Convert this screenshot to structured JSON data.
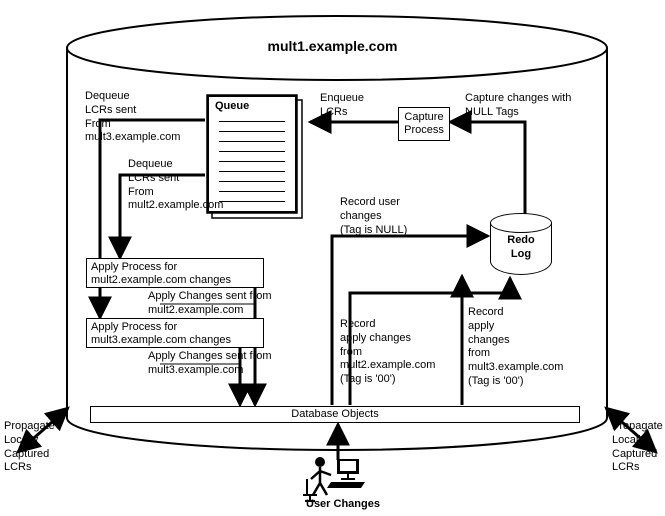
{
  "title": "mult1.example.com",
  "queue_label": "Queue",
  "capture_box": "Capture\nProcess",
  "redo_label": "Redo\nLog",
  "apply2_box": "Apply Process for\nmult2.example.com changes",
  "apply3_box": "Apply Process for\nmult3.example.com changes",
  "db_objects": "Database Objects",
  "user_changes_label": "User Changes",
  "left_prop": "Propagate\nLocally\nCaptured\nLCRs",
  "right_prop": "Propagate\nLocally\nCaptured\nLCRs",
  "dequeue_mult3": "Dequeue\nLCRs sent\nFrom\nmult3.example.com",
  "dequeue_mult2": "Dequeue\nLCRs sent\nFrom\nmult2.example.com",
  "enqueue_lcrs": "Enqueue\nLCRs",
  "capture_null": "Capture changes with\nNULL Tags",
  "record_user": "Record user\nchanges\n(Tag is NULL)",
  "apply_sent_m2": "Apply Changes sent from\nmult2.example.com",
  "apply_sent_m3": "Apply Changes sent from\nmult3.example.com",
  "record_apply_m2": "Record\napply changes\nfrom\nmult2.example.com\n(Tag is '00')",
  "record_apply_m3": "Record\napply\nchanges\nfrom\nmult3.example.com\n(Tag is '00')",
  "chart_data": {
    "type": "diagram",
    "host": "mult1.example.com",
    "nodes": [
      {
        "id": "queue",
        "label": "Queue"
      },
      {
        "id": "capture",
        "label": "Capture Process"
      },
      {
        "id": "redo",
        "label": "Redo Log"
      },
      {
        "id": "apply_m2",
        "label": "Apply Process for mult2.example.com changes"
      },
      {
        "id": "apply_m3",
        "label": "Apply Process for mult3.example.com changes"
      },
      {
        "id": "db_objects",
        "label": "Database Objects"
      },
      {
        "id": "user",
        "label": "User Changes"
      }
    ],
    "edges": [
      {
        "from": "redo",
        "to": "capture",
        "label": "Capture changes with NULL Tags"
      },
      {
        "from": "capture",
        "to": "queue",
        "label": "Enqueue LCRs"
      },
      {
        "from": "queue",
        "to": "apply_m3",
        "label": "Dequeue LCRs sent From mult3.example.com"
      },
      {
        "from": "queue",
        "to": "apply_m2",
        "label": "Dequeue LCRs sent From mult2.example.com"
      },
      {
        "from": "apply_m2",
        "to": "db_objects",
        "label": "Apply Changes sent from mult2.example.com"
      },
      {
        "from": "apply_m3",
        "to": "db_objects",
        "label": "Apply Changes sent from mult3.example.com"
      },
      {
        "from": "user",
        "to": "db_objects",
        "label": "User Changes"
      },
      {
        "from": "db_objects",
        "to": "redo",
        "label": "Record user changes (Tag is NULL)"
      },
      {
        "from": "db_objects",
        "to": "redo",
        "label": "Record apply changes from mult2.example.com (Tag is '00')"
      },
      {
        "from": "db_objects",
        "to": "redo",
        "label": "Record apply changes from mult3.example.com (Tag is '00')"
      },
      {
        "from": "queue",
        "to": "external_left",
        "label": "Propagate Locally Captured LCRs"
      },
      {
        "from": "queue",
        "to": "external_right",
        "label": "Propagate Locally Captured LCRs"
      }
    ]
  }
}
